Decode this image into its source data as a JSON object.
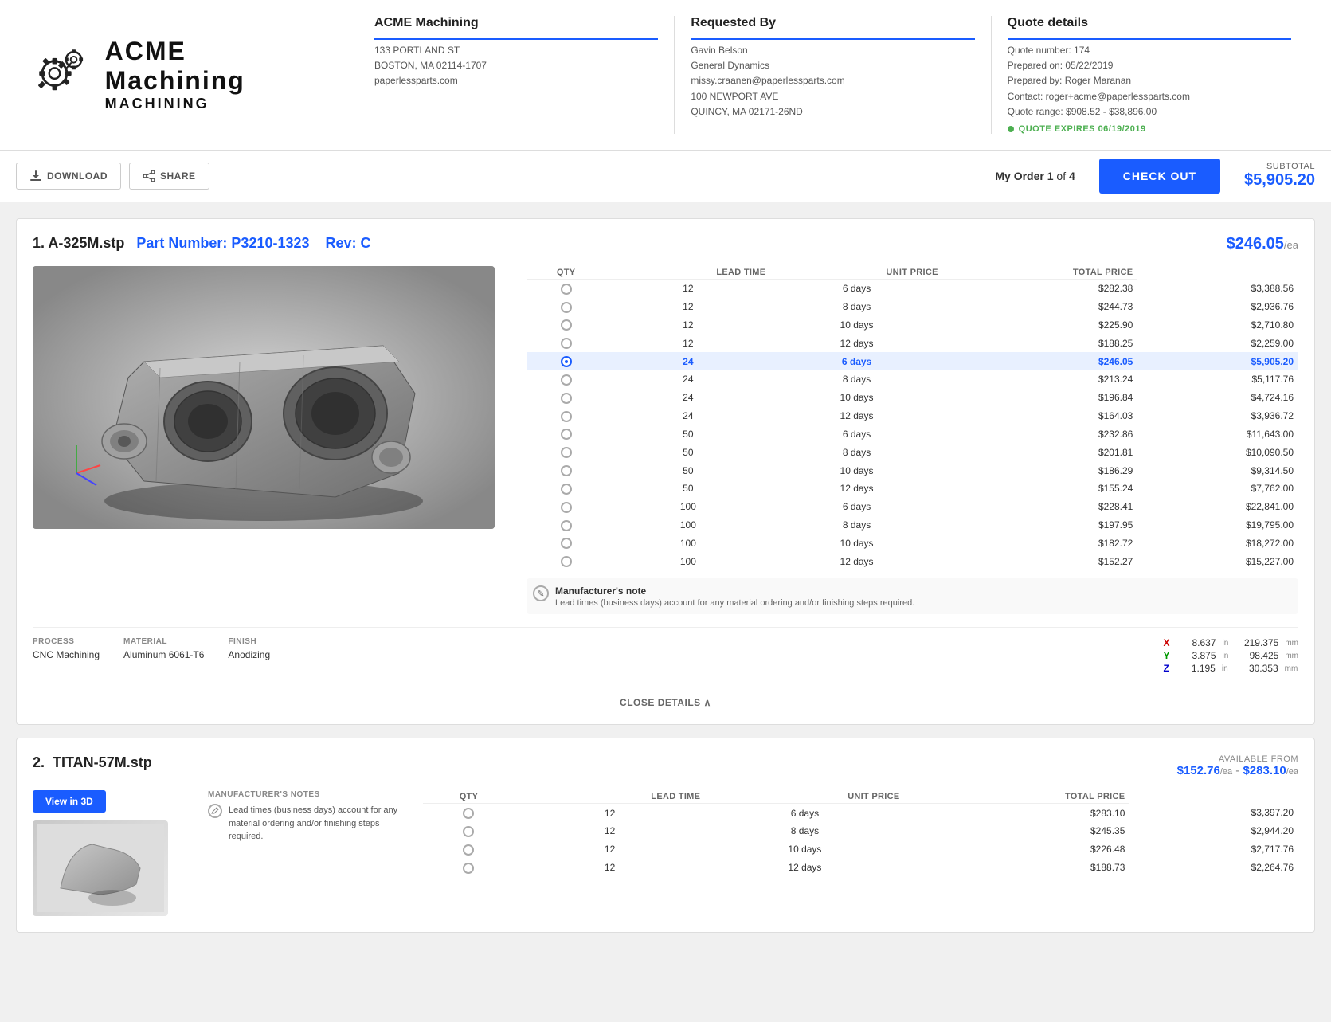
{
  "company": {
    "name": "ACME Machining",
    "address_line1": "133 PORTLAND ST",
    "address_line2": "BOSTON, MA 02114-1707",
    "website": "paperlessparts.com"
  },
  "requested_by": {
    "label": "Requested By",
    "name": "Gavin Belson",
    "company": "General Dynamics",
    "email": "missy.craanen@paperlessparts.com",
    "address_line1": "100 NEWPORT AVE",
    "address_line2": "QUINCY, MA 02171-26ND"
  },
  "quote_details": {
    "label": "Quote details",
    "number_label": "Quote number: 174",
    "prepared_on": "Prepared on: 05/22/2019",
    "prepared_by": "Prepared by: Roger Maranan",
    "contact": "Contact: roger+acme@paperlessparts.com",
    "range": "Quote range: $908.52 - $38,896.00",
    "expires_label": "QUOTE EXPIRES 06/19/2019"
  },
  "toolbar": {
    "download_label": "DOWNLOAD",
    "share_label": "SHARE",
    "order_label": "My Order",
    "order_current": "1",
    "order_total": "4",
    "checkout_label": "CHECK OUT",
    "subtotal_label": "SUBTOTAL",
    "subtotal_amount": "$5,905.20"
  },
  "part1": {
    "number": "1.",
    "name": "A-325M.stp",
    "part_number_label": "Part Number: P3210-1323",
    "rev_label": "Rev: C",
    "price_per_ea": "$246.05",
    "per_ea": "/ea",
    "process_label": "PROCESS",
    "process_value": "CNC Machining",
    "material_label": "MATERIAL",
    "material_value": "Aluminum 6061-T6",
    "finish_label": "FINISH",
    "finish_value": "Anodizing",
    "dimensions": {
      "x_in": "8.637",
      "x_in_unit": "in",
      "x_mm": "219.375",
      "x_mm_unit": "mm",
      "y_in": "3.875",
      "y_in_unit": "in",
      "y_mm": "98.425",
      "y_mm_unit": "mm",
      "z_in": "1.195",
      "z_in_unit": "in",
      "z_mm": "30.353",
      "z_mm_unit": "mm"
    },
    "pricing_headers": {
      "qty": "QTY",
      "lead_time": "LEAD TIME",
      "unit_price": "UNIT PRICE",
      "total_price": "TOTAL PRICE"
    },
    "pricing_rows": [
      {
        "qty": "12",
        "lead": "6 days",
        "unit": "$282.38",
        "total": "$3,388.56",
        "selected": false
      },
      {
        "qty": "12",
        "lead": "8 days",
        "unit": "$244.73",
        "total": "$2,936.76",
        "selected": false
      },
      {
        "qty": "12",
        "lead": "10 days",
        "unit": "$225.90",
        "total": "$2,710.80",
        "selected": false
      },
      {
        "qty": "12",
        "lead": "12 days",
        "unit": "$188.25",
        "total": "$2,259.00",
        "selected": false
      },
      {
        "qty": "24",
        "lead": "6 days",
        "unit": "$246.05",
        "total": "$5,905.20",
        "selected": true
      },
      {
        "qty": "24",
        "lead": "8 days",
        "unit": "$213.24",
        "total": "$5,117.76",
        "selected": false
      },
      {
        "qty": "24",
        "lead": "10 days",
        "unit": "$196.84",
        "total": "$4,724.16",
        "selected": false
      },
      {
        "qty": "24",
        "lead": "12 days",
        "unit": "$164.03",
        "total": "$3,936.72",
        "selected": false
      },
      {
        "qty": "50",
        "lead": "6 days",
        "unit": "$232.86",
        "total": "$11,643.00",
        "selected": false
      },
      {
        "qty": "50",
        "lead": "8 days",
        "unit": "$201.81",
        "total": "$10,090.50",
        "selected": false
      },
      {
        "qty": "50",
        "lead": "10 days",
        "unit": "$186.29",
        "total": "$9,314.50",
        "selected": false
      },
      {
        "qty": "50",
        "lead": "12 days",
        "unit": "$155.24",
        "total": "$7,762.00",
        "selected": false
      },
      {
        "qty": "100",
        "lead": "6 days",
        "unit": "$228.41",
        "total": "$22,841.00",
        "selected": false
      },
      {
        "qty": "100",
        "lead": "8 days",
        "unit": "$197.95",
        "total": "$19,795.00",
        "selected": false
      },
      {
        "qty": "100",
        "lead": "10 days",
        "unit": "$182.72",
        "total": "$18,272.00",
        "selected": false
      },
      {
        "qty": "100",
        "lead": "12 days",
        "unit": "$152.27",
        "total": "$15,227.00",
        "selected": false
      }
    ],
    "manufacturer_note_title": "Manufacturer's note",
    "manufacturer_note_text": "Lead times (business days) account for any material ordering and/or finishing steps required.",
    "close_details_label": "CLOSE DETAILS"
  },
  "part2": {
    "number": "2.",
    "name": "TITAN-57M.stp",
    "available_from_label": "AVAILABLE FROM",
    "price_low": "$152.76",
    "price_low_unit": "/ea",
    "price_sep": " - ",
    "price_high": "$283.10",
    "price_high_unit": "/ea",
    "view_3d_label": "View in 3D",
    "mfg_notes_label": "MANUFACTURER'S NOTES",
    "mfg_note_text": "Lead times (business days) account for any material ordering and/or finishing steps required.",
    "pricing_headers": {
      "qty": "QTY",
      "lead_time": "LEAD TIME",
      "unit_price": "UNIT PRICE",
      "total_price": "TOTAL PRICE"
    },
    "pricing_rows": [
      {
        "qty": "12",
        "lead": "6 days",
        "unit": "$283.10",
        "total": "$3,397.20",
        "selected": false
      },
      {
        "qty": "12",
        "lead": "8 days",
        "unit": "$245.35",
        "total": "$2,944.20",
        "selected": false
      },
      {
        "qty": "12",
        "lead": "10 days",
        "unit": "$226.48",
        "total": "$2,717.76",
        "selected": false
      },
      {
        "qty": "12",
        "lead": "12 days",
        "unit": "$188.73",
        "total": "$2,264.76",
        "selected": false
      }
    ]
  }
}
